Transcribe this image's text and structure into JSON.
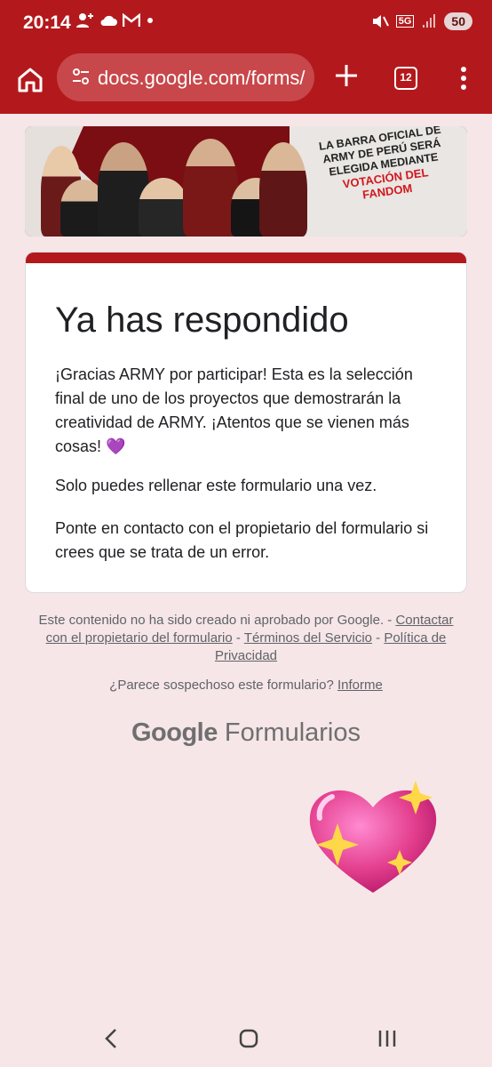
{
  "status_bar": {
    "time": "20:14",
    "battery": "50",
    "network": "5G"
  },
  "browser": {
    "url": "docs.google.com/forms/",
    "tab_count": "12"
  },
  "banner": {
    "line1": "LA BARRA OFICIAL DE",
    "line2": "ARMY DE PERÚ SERÁ",
    "line3": "ELEGIDA MEDIANTE",
    "line4": "VOTACIÓN DEL",
    "line5": "FANDOM"
  },
  "card": {
    "title": "Ya has respondido",
    "message": "¡Gracias ARMY por participar! Esta es la selección final de uno de los proyectos que demostrarán la creatividad de ARMY. ¡Atentos que se vienen más cosas! 💜",
    "once": "Solo puedes rellenar este formulario una vez.",
    "contact": "Ponte en contacto con el propietario del formulario si crees que se trata de un error."
  },
  "footer": {
    "disclaimer": "Este contenido no ha sido creado ni aprobado por Google.",
    "separator": " - ",
    "contact_link": "Contactar con el propietario del formulario",
    "terms_link": "Términos del Servicio",
    "privacy_link": "Política de Privacidad",
    "suspicious_text": "¿Parece sospechoso este formulario?",
    "report_link": "Informe",
    "brand_google": "Google",
    "brand_forms": "Formularios"
  },
  "colors": {
    "theme": "#b3191c",
    "background": "#f6e6e8",
    "heart": "#e4408f"
  },
  "icons": [
    "home-icon",
    "site-settings-icon",
    "plus-icon",
    "tabs-icon",
    "more-vert-icon",
    "back-icon",
    "home-nav-icon",
    "recents-icon",
    "sparkling-heart-emoji"
  ]
}
